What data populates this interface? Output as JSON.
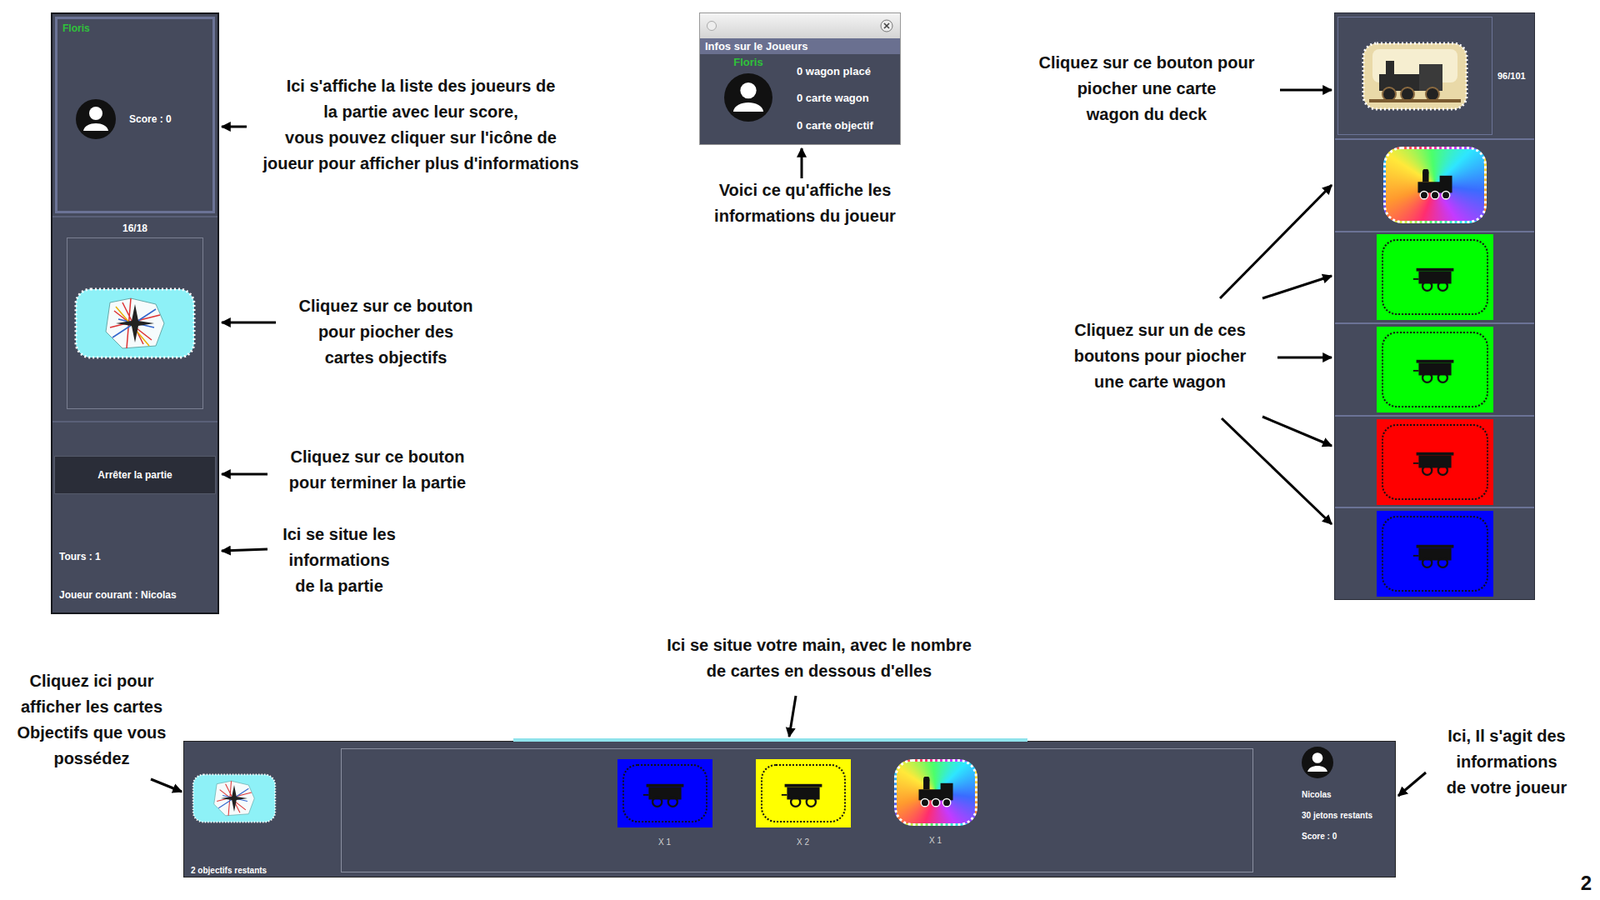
{
  "page_number": "2",
  "annotations": {
    "player_list": [
      "Ici s'affiche la liste des joueurs de",
      "la partie avec leur score,",
      "vous pouvez cliquer sur l'icône de",
      "joueur pour afficher plus d'informations"
    ],
    "objective_deck": [
      "Cliquez sur ce bouton",
      "pour piocher des",
      "cartes objectifs"
    ],
    "stop_button": [
      "Cliquez sur ce bouton",
      "pour terminer la partie"
    ],
    "game_info": [
      "Ici se situe les",
      "informations",
      "de la partie"
    ],
    "player_window": [
      "Voici ce qu'affiche les",
      "informations du joueur"
    ],
    "wagon_deck": [
      "Cliquez sur ce bouton pour",
      "piocher une carte",
      "wagon du deck"
    ],
    "face_up_cards": [
      "Cliquez sur un de ces",
      "boutons pour piocher",
      "une carte wagon"
    ],
    "hand": [
      "Ici se situe votre main, avec le nombre",
      "de cartes en dessous d'elles"
    ],
    "my_objectives": [
      "Cliquez ici pour",
      "afficher les cartes",
      "Objectifs que vous",
      "possédez"
    ],
    "my_player": [
      "Ici, Il s'agit des",
      "informations",
      "de votre joueur"
    ]
  },
  "left_panel": {
    "players": [
      {
        "name": "Floris",
        "score": "Score : 0",
        "color": "#2fc23a"
      }
    ],
    "objective_deck": {
      "count": "16/18"
    },
    "stop_button": "Arrêter la partie",
    "game_info": {
      "turns": "Tours : 1",
      "current_player": "Joueur courant : Nicolas"
    }
  },
  "player_info_window": {
    "title": "Infos sur le Joueurs",
    "player": {
      "name": "Floris",
      "color": "#2fc23a"
    },
    "stats": [
      "0 wagon placé",
      "0 carte wagon",
      "0 carte objectif"
    ]
  },
  "draw_panel": {
    "deck_count": "96/101",
    "face_up_cards": [
      {
        "kind": "locomotive"
      },
      {
        "kind": "wagon",
        "color": "#00ff00"
      },
      {
        "kind": "wagon",
        "color": "#00ff00"
      },
      {
        "kind": "wagon",
        "color": "#ff0000"
      },
      {
        "kind": "wagon",
        "color": "#0000ff"
      }
    ]
  },
  "bottom_bar": {
    "objectives_remaining": "2 objectifs restants",
    "hand": [
      {
        "kind": "wagon",
        "color": "#0000ff",
        "count": "X 1"
      },
      {
        "kind": "wagon",
        "color": "#ffff00",
        "count": "X 2"
      },
      {
        "kind": "locomotive",
        "count": "X 1"
      }
    ],
    "player": {
      "name": "Nicolas",
      "tokens": "30 jetons restants",
      "score": "Score : 0"
    }
  }
}
